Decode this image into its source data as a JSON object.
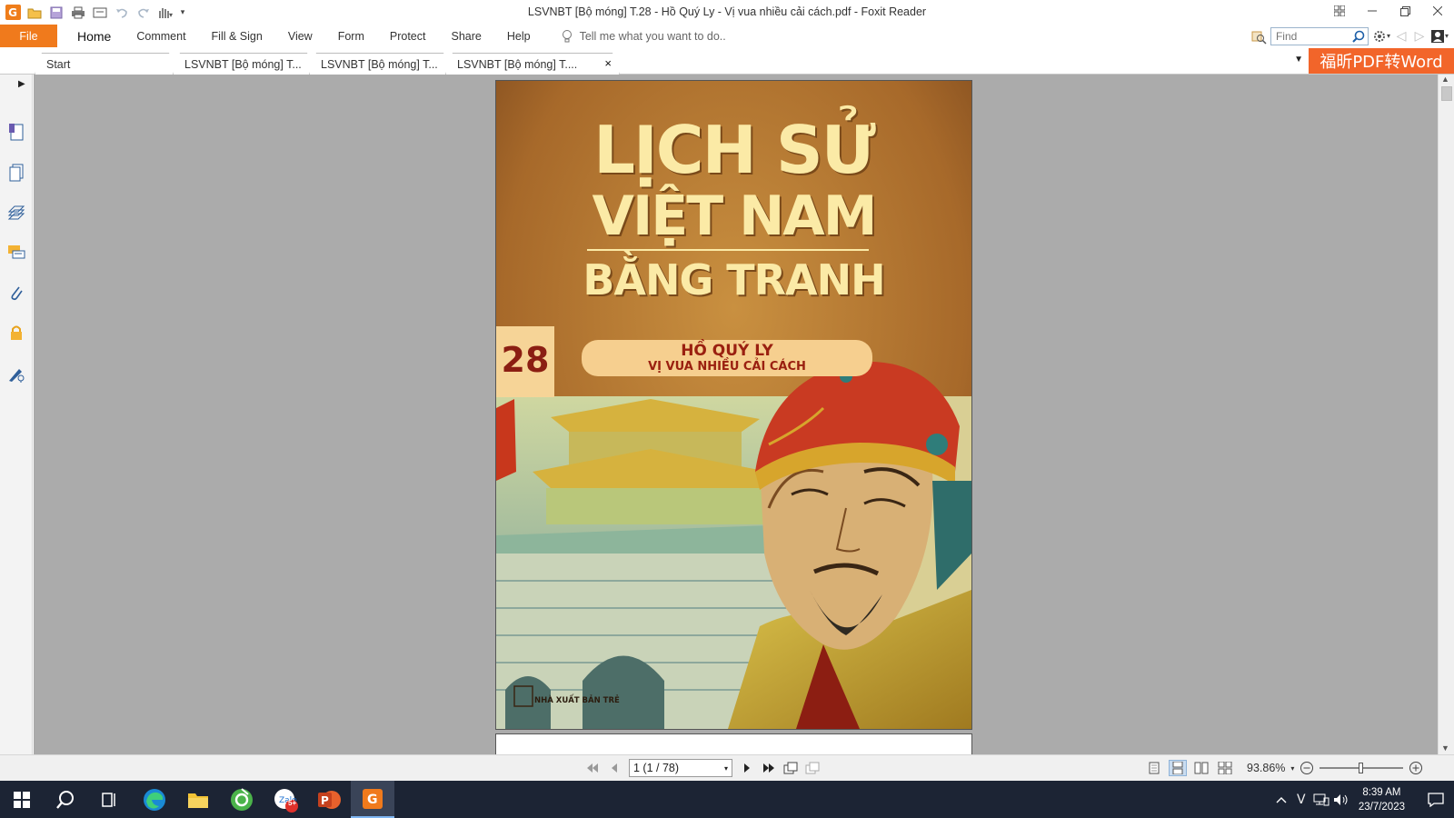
{
  "window": {
    "title": "LSVNBT [Bộ móng] T.28 - Hồ Quý Ly - Vị vua nhiều cải cách.pdf - Foxit Reader",
    "app_icon_letter": "G"
  },
  "menu": {
    "file": "File",
    "items": [
      "Home",
      "Comment",
      "Fill & Sign",
      "View",
      "Form",
      "Protect",
      "Share",
      "Help"
    ],
    "active": "Home",
    "tell_me": "Tell me what you want to do..",
    "find_placeholder": "Find"
  },
  "tabs": [
    {
      "label": "Start"
    },
    {
      "label": "LSVNBT [Bộ móng] T..."
    },
    {
      "label": "LSVNBT [Bộ móng] T..."
    },
    {
      "label": "LSVNBT [Bộ móng] T....",
      "active": true,
      "close": "×"
    }
  ],
  "banner": "福昕PDF转Word",
  "cover": {
    "title_line1": "LỊCH SỬ",
    "title_line2": "VIỆT NAM",
    "title_line3": "BẰNG TRANH",
    "volume": "28",
    "subtitle_line1": "HỒ QUÝ LY",
    "subtitle_line2": "VỊ VUA NHIỀU CẢI CÁCH",
    "publisher": "NHÀ XUẤT BẢN TRẺ",
    "colors": {
      "cover_top": "#b6782f",
      "title_text": "#fbeaa6",
      "band": "#f3c98a",
      "volume_text": "#8b1e12",
      "subtitle_text": "#9a2010"
    }
  },
  "statusbar": {
    "page_display": "1 (1 / 78)",
    "zoom": "93.86%",
    "zoom_level": 0.5
  },
  "taskbar": {
    "time": "8:39 AM",
    "date": "23/7/2023",
    "badge": "5+"
  },
  "colors": {
    "accent": "#f07a1c",
    "doc_background": "#ababab",
    "taskbar": "#1c2434"
  }
}
